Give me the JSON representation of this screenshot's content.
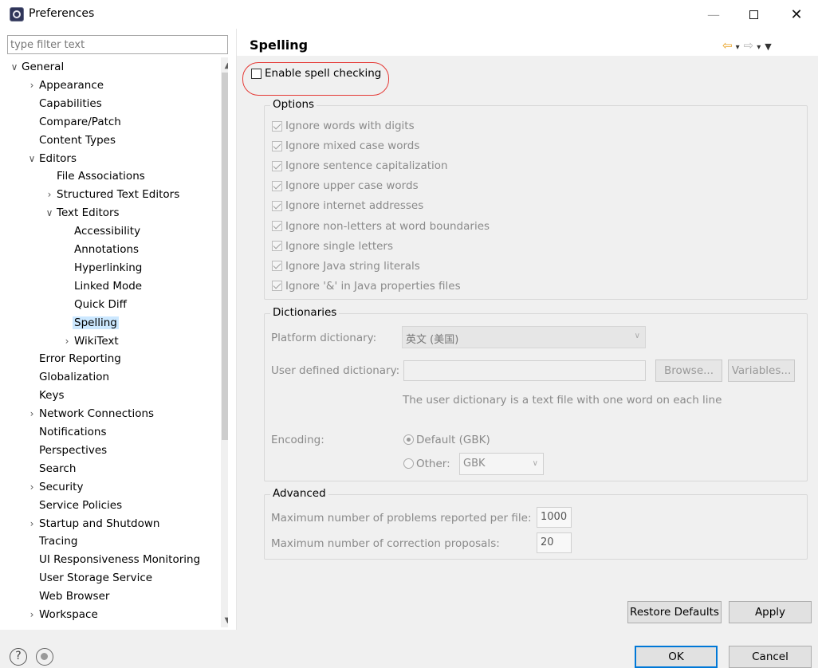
{
  "window": {
    "title": "Preferences",
    "minimize": "—",
    "close": "✕"
  },
  "filter": {
    "placeholder": "type filter text"
  },
  "tree": {
    "items": [
      {
        "label": "General",
        "toggle": "∨",
        "level": 0
      },
      {
        "label": "Appearance",
        "toggle": "›",
        "level": 1
      },
      {
        "label": "Capabilities",
        "toggle": "",
        "level": 1
      },
      {
        "label": "Compare/Patch",
        "toggle": "",
        "level": 1
      },
      {
        "label": "Content Types",
        "toggle": "",
        "level": 1
      },
      {
        "label": "Editors",
        "toggle": "∨",
        "level": 1
      },
      {
        "label": "File Associations",
        "toggle": "",
        "level": 2
      },
      {
        "label": "Structured Text Editors",
        "toggle": "›",
        "level": 2
      },
      {
        "label": "Text Editors",
        "toggle": "∨",
        "level": 2
      },
      {
        "label": "Accessibility",
        "toggle": "",
        "level": 3
      },
      {
        "label": "Annotations",
        "toggle": "",
        "level": 3
      },
      {
        "label": "Hyperlinking",
        "toggle": "",
        "level": 3
      },
      {
        "label": "Linked Mode",
        "toggle": "",
        "level": 3
      },
      {
        "label": "Quick Diff",
        "toggle": "",
        "level": 3
      },
      {
        "label": "Spelling",
        "toggle": "",
        "level": 3,
        "selected": true
      },
      {
        "label": "WikiText",
        "toggle": "›",
        "level": 3
      },
      {
        "label": "Error Reporting",
        "toggle": "",
        "level": 1
      },
      {
        "label": "Globalization",
        "toggle": "",
        "level": 1
      },
      {
        "label": "Keys",
        "toggle": "",
        "level": 1
      },
      {
        "label": "Network Connections",
        "toggle": "›",
        "level": 1
      },
      {
        "label": "Notifications",
        "toggle": "",
        "level": 1
      },
      {
        "label": "Perspectives",
        "toggle": "",
        "level": 1
      },
      {
        "label": "Search",
        "toggle": "",
        "level": 1
      },
      {
        "label": "Security",
        "toggle": "›",
        "level": 1
      },
      {
        "label": "Service Policies",
        "toggle": "",
        "level": 1
      },
      {
        "label": "Startup and Shutdown",
        "toggle": "›",
        "level": 1
      },
      {
        "label": "Tracing",
        "toggle": "",
        "level": 1
      },
      {
        "label": "UI Responsiveness Monitoring",
        "toggle": "",
        "level": 1
      },
      {
        "label": "User Storage Service",
        "toggle": "",
        "level": 1
      },
      {
        "label": "Web Browser",
        "toggle": "",
        "level": 1
      },
      {
        "label": "Workspace",
        "toggle": "›",
        "level": 1
      }
    ]
  },
  "page": {
    "title": "Spelling",
    "nav": {
      "back": "⇦",
      "dropdown": "▾",
      "forward": "⇨",
      "menu": "▼"
    },
    "enable_label": "Enable spell checking",
    "options": {
      "title": "Options",
      "items": [
        "Ignore words with digits",
        "Ignore mixed case words",
        "Ignore sentence capitalization",
        "Ignore upper case words",
        "Ignore internet addresses",
        "Ignore non-letters at word boundaries",
        "Ignore single letters",
        "Ignore Java string literals",
        "Ignore '&' in Java properties files"
      ]
    },
    "dictionaries": {
      "title": "Dictionaries",
      "platform_label": "Platform dictionary:",
      "platform_value": "英文 (美国)",
      "user_label": "User defined dictionary:",
      "browse": "Browse...",
      "variables": "Variables...",
      "hint": "The user dictionary is a text file with one word on each line",
      "encoding_label": "Encoding:",
      "default_label": "Default (GBK)",
      "other_label": "Other:",
      "other_value": "GBK"
    },
    "advanced": {
      "title": "Advanced",
      "max_problems_label": "Maximum number of problems reported per file:",
      "max_problems_value": "1000",
      "max_corrections_label": "Maximum number of correction proposals:",
      "max_corrections_value": "20"
    },
    "restore_defaults": "Restore Defaults",
    "apply": "Apply"
  },
  "footer": {
    "help": "?",
    "ok": "OK",
    "cancel": "Cancel"
  }
}
